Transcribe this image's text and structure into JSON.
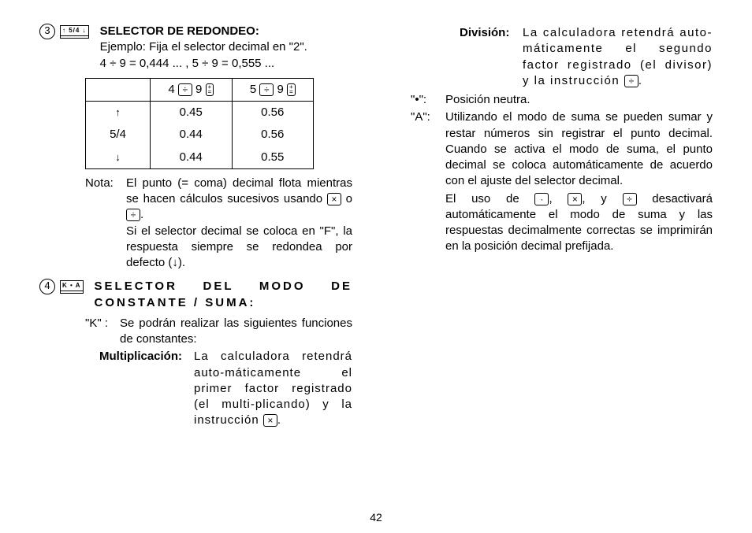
{
  "section3": {
    "number": "3",
    "switch_label": "↑ 5/4 ↓",
    "title": "SELECTOR DE REDONDEO:",
    "example": "Ejemplo: Fija el selector decimal en \"2\".",
    "formula": "4 ÷ 9 = 0,444 ... ,  5 ÷ 9 = 0,555 ...",
    "table": {
      "header": {
        "col1_a": "4",
        "col1_b": "9",
        "col2_a": "5",
        "col2_b": "9"
      },
      "rows": [
        {
          "label": "↑",
          "c1": "0.45",
          "c2": "0.56"
        },
        {
          "label": "5/4",
          "c1": "0.44",
          "c2": "0.56"
        },
        {
          "label": "↓",
          "c1": "0.44",
          "c2": "0.55"
        }
      ]
    },
    "note_label": "Nota:",
    "note_pre": "El punto (= coma) decimal flota mientras se hacen cálculos sucesivos usando ",
    "note_mid": " o ",
    "note_end": ".",
    "note2": "Si el selector decimal se coloca en \"F\", la respuesta siempre se redondea por defecto (↓)."
  },
  "section4": {
    "number": "4",
    "switch_label": "K  •  A",
    "title": "SELECTOR DEL MODO DE CONSTANTE / SUMA:",
    "k_label": "\"K\" :",
    "k_text": "Se podrán realizar las siguientes funciones de constantes:",
    "mult_label": "Multiplicación:",
    "mult_body_pre": "La calculadora retendrá auto-máticamente el primer factor registrado (el multi-plicando) y la instrucción ",
    "mult_body_end": ".",
    "div_label": "División:",
    "div_body_pre": "La calculadora retendrá auto-máticamente el segundo factor registrado (el divisor) y la instrucción ",
    "div_body_end": ".",
    "dot_label": "\"•\":",
    "dot_text": "Posición neutra.",
    "a_label": "\"A\":",
    "a_text": "Utilizando el modo de suma se pueden sumar y restar números sin registrar el punto decimal. Cuando se activa el modo de suma, el punto decimal se coloca automáticamente de acuerdo con el ajuste del selector decimal.",
    "a_text2_pre": "El uso de ",
    "a_text2_mid1": ", ",
    "a_text2_mid2": ", y ",
    "a_text2_end": " desactivará automáticamente el modo de suma y las respuestas decimalmente correctas se imprimirán en la posición decimal prefijada."
  },
  "page_number": "42"
}
